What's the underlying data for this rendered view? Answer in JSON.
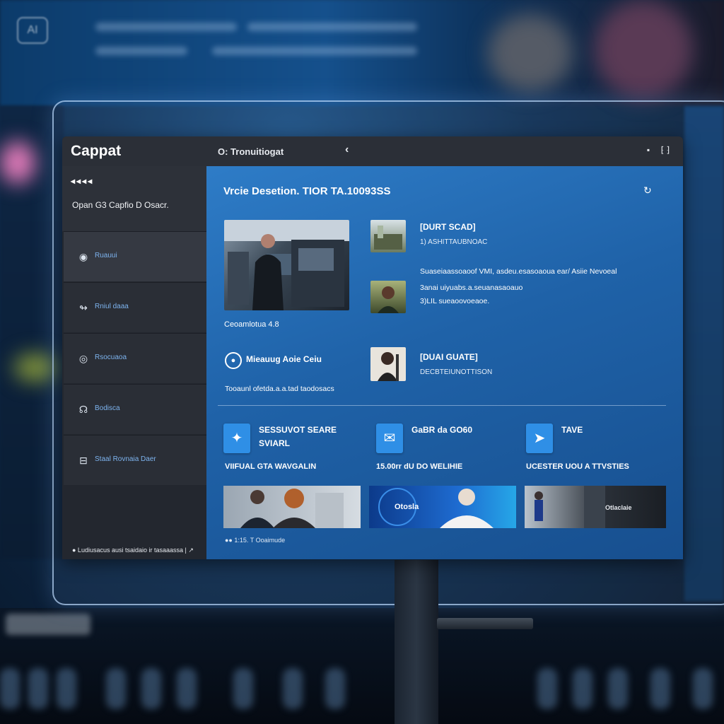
{
  "background": {
    "logo_text": "AI"
  },
  "window": {
    "app_name": "Cappat",
    "title": "O: Tronuitiogat",
    "back_icon": "chevron-left-icon",
    "controls": [
      "▪",
      "⁅ ⁆"
    ]
  },
  "sidebar": {
    "dots": "◂◂◂◂",
    "subtitle": "Opan G3 Capfio D Osacr.",
    "items": [
      {
        "label": "Ruauui",
        "icon": "circle-target-icon",
        "glyph": "◉"
      },
      {
        "label": "Rniul daaa",
        "icon": "wave-icon",
        "glyph": "↬"
      },
      {
        "label": "Rsocuaoa",
        "icon": "circle-icon",
        "glyph": "◎"
      },
      {
        "label": "Bodisca",
        "icon": "dial-icon",
        "glyph": "☊"
      },
      {
        "label": "Staal Rovnaia Daer",
        "icon": "goggles-icon",
        "glyph": "⊟"
      }
    ],
    "footer": "● Ludiusacus ausi tsaidaio ir tasaaassa | ↗"
  },
  "main": {
    "title": "Vrcie Desetion. TIOR TA.10093SS",
    "refresh_icon": "refresh-icon",
    "featured_caption": "Ceoamlotua 4.8",
    "items": [
      {
        "title": "[DURT SCAD]",
        "sub": "1) ASHITTAUBNOAC"
      },
      {
        "title": "[DUAI GUATE]",
        "sub": "DECBTEIUNOTTISON"
      }
    ],
    "desc_lines": [
      "Suaseiaassoaoof VMI, asdeu.esasoaoua ear/ Asiie Nevoeal",
      "3anai uiyuabs.a.seuanasaoauo",
      "3)LIL sueaoovoeaoe."
    ],
    "message_label": "Mieauug Aoie Ceiu",
    "message_icon": "location-pin-icon",
    "message_caption": "Tooaunl ofetda.a.a.tad taodosacs",
    "features": [
      {
        "title_1": "SESSUVOT SEARE",
        "title_2": "SVIARL",
        "sub": "VIIFUAL GTA WAVGALIN",
        "icon": "chat-bubble-icon",
        "glyph": "✦"
      },
      {
        "title_1": "GaBR da GO60",
        "title_2": "",
        "sub": "15.00rr dU DO WELIHIE",
        "icon": "mail-icon",
        "glyph": "✉"
      },
      {
        "title_1": "TAVE",
        "title_2": "",
        "sub": "UCESTER UOU A TTVSTIES",
        "icon": "send-icon",
        "glyph": "➤"
      }
    ],
    "bottom_thumbs": [
      {
        "label": ""
      },
      {
        "label": "Otosla"
      },
      {
        "label": "Otlaclaie"
      }
    ],
    "bottom_caption": "●● 1:15.  T Ooaimude"
  }
}
